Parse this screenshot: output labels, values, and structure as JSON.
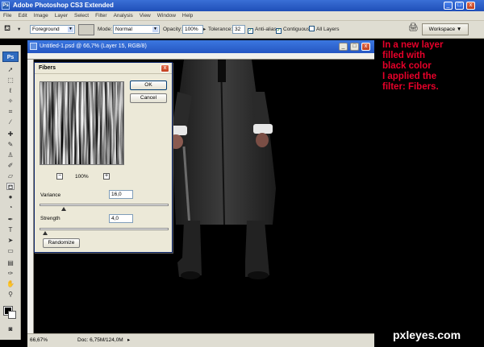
{
  "app": {
    "title": "Adobe Photoshop CS3 Extended",
    "icon_name": "photoshop-icon"
  },
  "menu": [
    "File",
    "Edit",
    "Image",
    "Layer",
    "Select",
    "Filter",
    "Analysis",
    "View",
    "Window",
    "Help"
  ],
  "options_bar": {
    "fill_select": "Foreground",
    "mode_label": "Mode:",
    "mode_value": "Normal",
    "opacity_label": "Opacity:",
    "opacity_value": "100%",
    "tolerance_label": "Tolerance:",
    "tolerance_value": "32",
    "anti_alias_label": "Anti-alias",
    "contiguous_label": "Contiguous",
    "all_layers_label": "All Layers",
    "workspace_label": "Workspace ▼"
  },
  "document": {
    "title": "Untitled-1.psd @ 66,7% (Layer 15, RGB/8)",
    "zoom_status": "66,67%",
    "doc_status": "Doc: 6,75M/124,0M"
  },
  "fibers_dialog": {
    "title": "Fibers",
    "ok_label": "OK",
    "cancel_label": "Cancel",
    "zoom_label": "100%",
    "zoom_out_label": "−",
    "zoom_in_label": "+",
    "variance_label": "Variance",
    "variance_value": "16,0",
    "variance_level": 0.18,
    "strength_label": "Strength",
    "strength_value": "4,0",
    "strength_level": 0.04,
    "randomize_label": "Randomize"
  },
  "annotation": {
    "text": "In a new layer\nfilled with\nblack color\nI applied the\nfilter: Fibers."
  },
  "watermark": "pxleyes.com",
  "colors": {
    "annotation": "#e8002a",
    "title_bar": "#2556c2"
  }
}
